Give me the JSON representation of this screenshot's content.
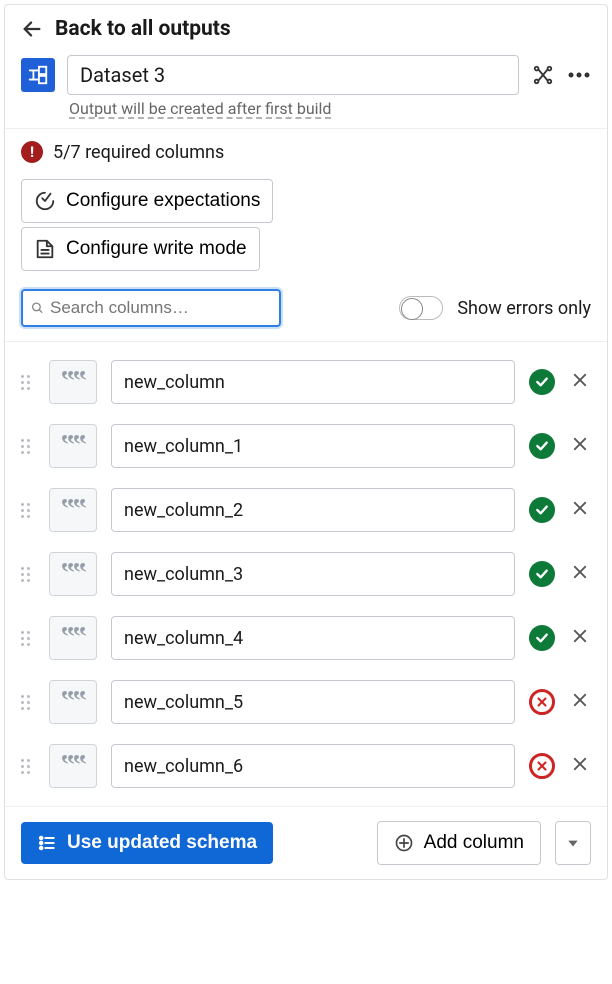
{
  "header": {
    "back_label": "Back to all outputs",
    "dataset_title": "Dataset 3",
    "output_note": "Output will be created after first build"
  },
  "warning": {
    "required_text": "5/7 required columns"
  },
  "buttons": {
    "configure_expectations": "Configure expectations",
    "configure_write_mode": "Configure write mode",
    "use_updated_schema": "Use updated schema",
    "add_column": "Add column"
  },
  "search": {
    "placeholder": "Search columns…",
    "toggle_label": "Show errors only"
  },
  "columns": [
    {
      "name": "new_column",
      "ok": true
    },
    {
      "name": "new_column_1",
      "ok": true
    },
    {
      "name": "new_column_2",
      "ok": true
    },
    {
      "name": "new_column_3",
      "ok": true
    },
    {
      "name": "new_column_4",
      "ok": true
    },
    {
      "name": "new_column_5",
      "ok": false
    },
    {
      "name": "new_column_6",
      "ok": false
    }
  ]
}
